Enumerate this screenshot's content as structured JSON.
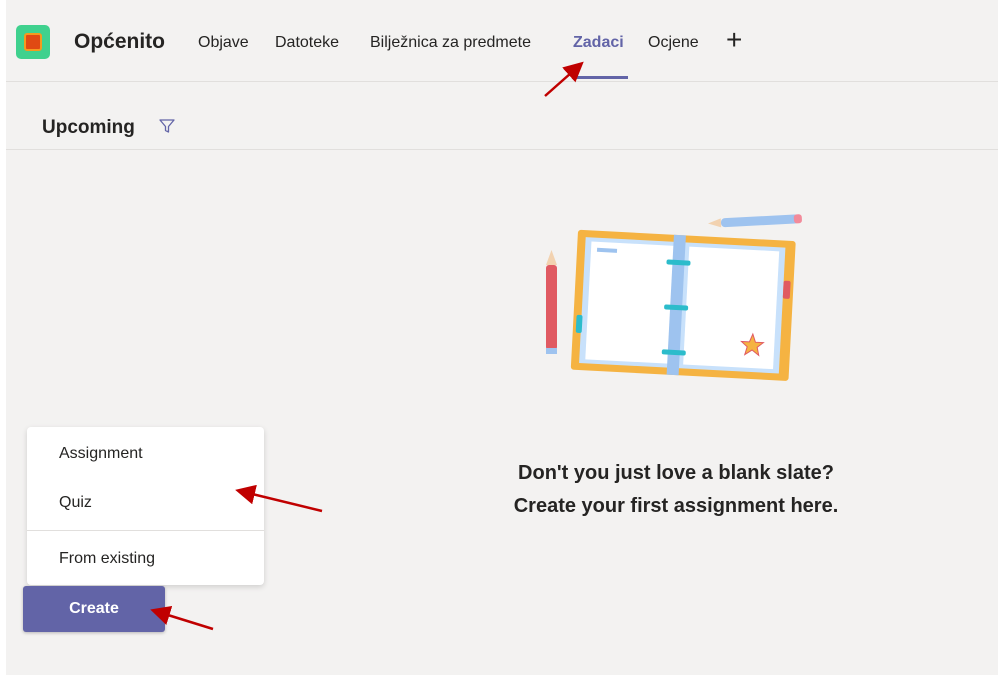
{
  "header": {
    "channel_name": "Općenito",
    "tabs": [
      {
        "label": "Objave"
      },
      {
        "label": "Datoteke"
      },
      {
        "label": "Bilježnica za predmete"
      },
      {
        "label": "Zadaci",
        "active": true
      },
      {
        "label": "Ocjene"
      }
    ],
    "add_tab_icon": "plus-icon",
    "team_logo_icon": "team-logo-icon"
  },
  "filterbar": {
    "label": "Upcoming",
    "icon": "filter-icon"
  },
  "empty_state": {
    "line1": "Don't you just love a blank slate?",
    "line2": "Create your first assignment here."
  },
  "create_menu": {
    "items": [
      {
        "label": "Assignment"
      },
      {
        "label": "Quiz"
      },
      {
        "label": "From existing"
      }
    ]
  },
  "create_button": {
    "label": "Create"
  },
  "colors": {
    "accent": "#6264a7",
    "annotation_arrow": "#c00000",
    "background": "#f3f2f1"
  }
}
